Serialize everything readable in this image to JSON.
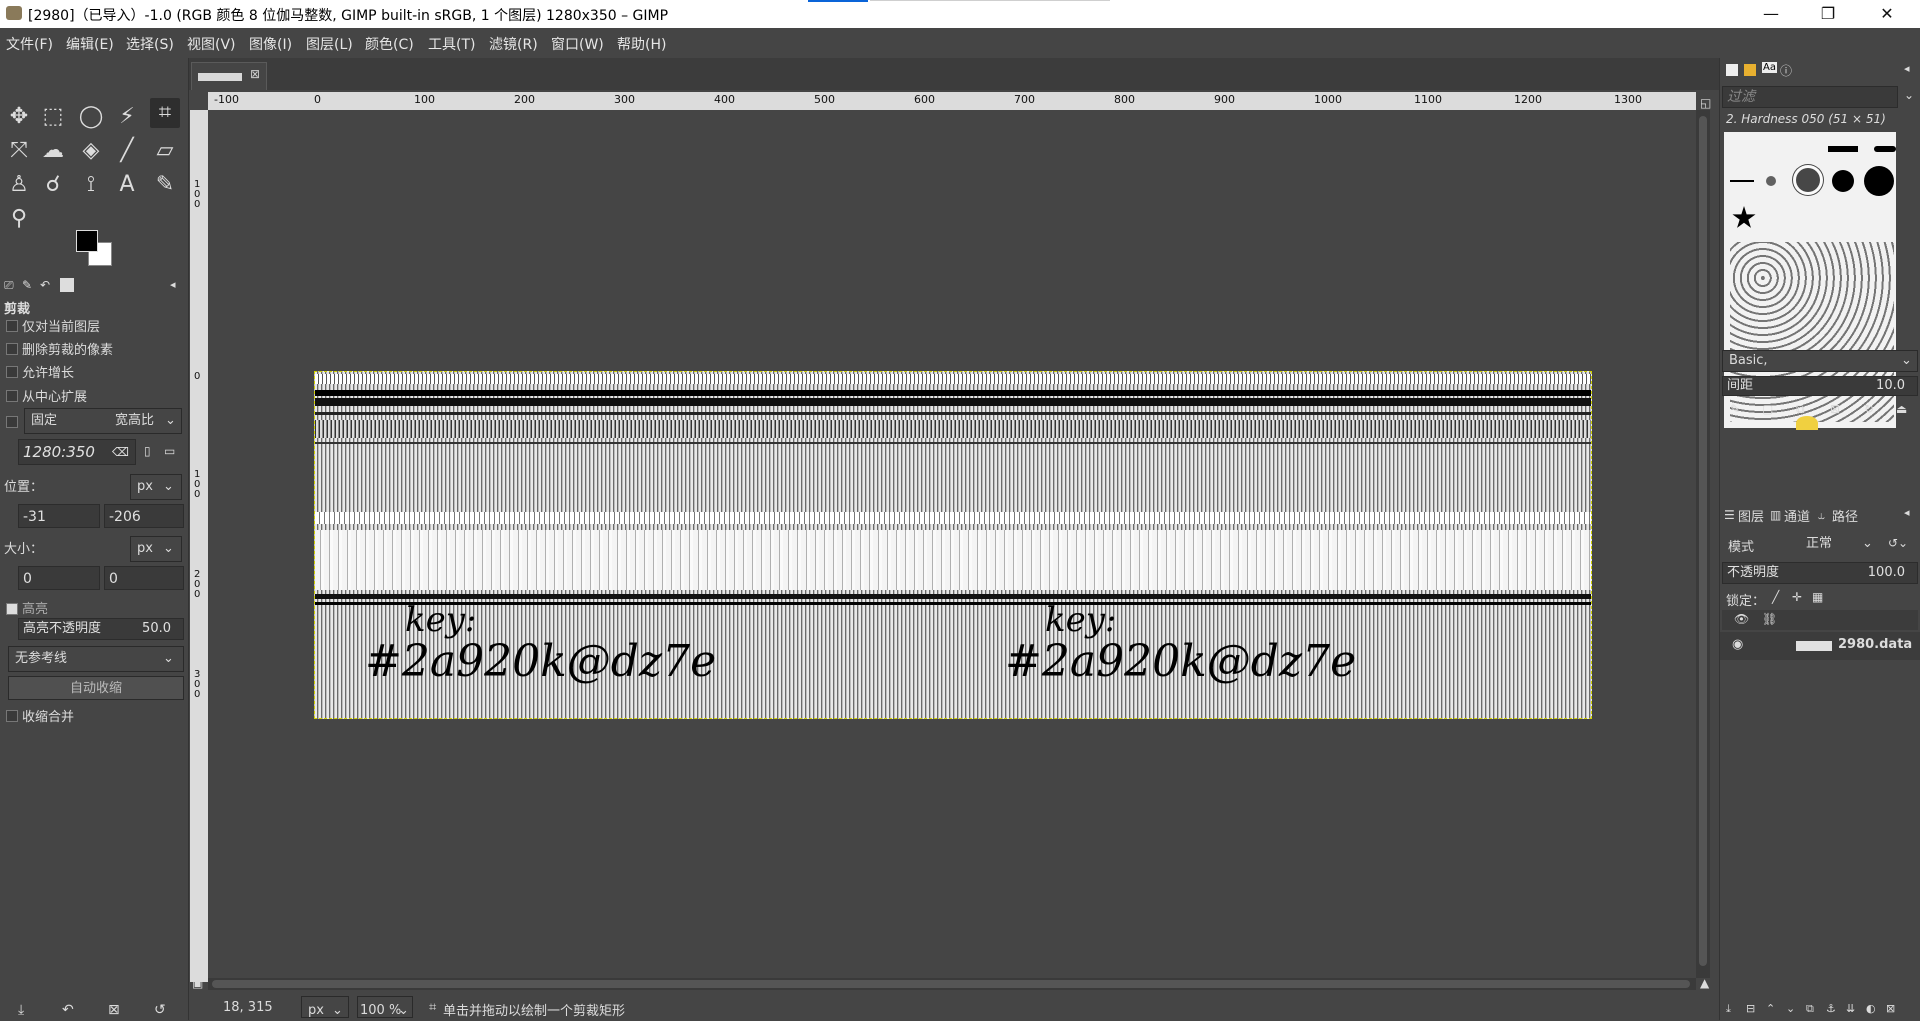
{
  "window": {
    "title": "[2980]（已导入）-1.0 (RGB 颜色 8 位伽马整数, GIMP built-in sRGB, 1 个图层) 1280x350 – GIMP",
    "minimize_glyph": "—",
    "maximize_glyph": "❐",
    "close_glyph": "✕"
  },
  "menu": [
    "文件(F)",
    "编辑(E)",
    "选择(S)",
    "视图(V)",
    "图像(I)",
    "图层(L)",
    "颜色(C)",
    "工具(T)",
    "滤镜(R)",
    "窗口(W)",
    "帮助(H)"
  ],
  "tool_options": {
    "title": "剪裁",
    "current_layer_only": "仅对当前图层",
    "delete_cropped": "删除剪裁的像素",
    "allow_grow": "允许增长",
    "expand_center": "从中心扩展",
    "fixed_label": "固定",
    "fixed_mode": "宽高比",
    "ratio_value": "1280:350",
    "position_label": "位置：",
    "position_unit": "px",
    "pos_x": "-31",
    "pos_y": "-206",
    "size_label": "大小：",
    "size_unit": "px",
    "size_w": "0",
    "size_h": "0",
    "highlight_label": "高亮",
    "highlight_opacity_label": "高亮不透明度",
    "highlight_opacity_value": "50.0",
    "guides": "无参考线",
    "auto_shrink": "自动收缩",
    "shrink_merged": "收缩合并"
  },
  "ruler": {
    "h_labels": [
      "-100",
      "0",
      "100",
      "200",
      "300",
      "400",
      "500",
      "600",
      "700",
      "800",
      "900",
      "1000",
      "1100",
      "1200",
      "1300"
    ],
    "v_labels": [
      "1 0 0",
      "0",
      "1 0 0",
      "2 0 0",
      "3 0 0"
    ]
  },
  "image_content": {
    "line1_left": "key:",
    "line2_left": "#2a920k@dz7e",
    "line1_right": "key:",
    "line2_right": "#2a920k@dz7e"
  },
  "status": {
    "coords": "18, 315",
    "unit": "px",
    "zoom": "100 %",
    "message": "单击并拖动以绘制一个剪裁矩形"
  },
  "brushes": {
    "filter_placeholder": "过滤",
    "selected_brush": "2. Hardness 050 (51 × 51)",
    "preset": "Basic,",
    "spacing_label": "间距",
    "spacing_value": "10.0"
  },
  "layers": {
    "tab_layers": "图层",
    "tab_channels": "通道",
    "tab_paths": "路径",
    "mode_label": "模式",
    "mode_value": "正常",
    "opacity_label": "不透明度",
    "opacity_value": "100.0",
    "lock_label": "锁定：",
    "layer_name": "2980.data"
  }
}
